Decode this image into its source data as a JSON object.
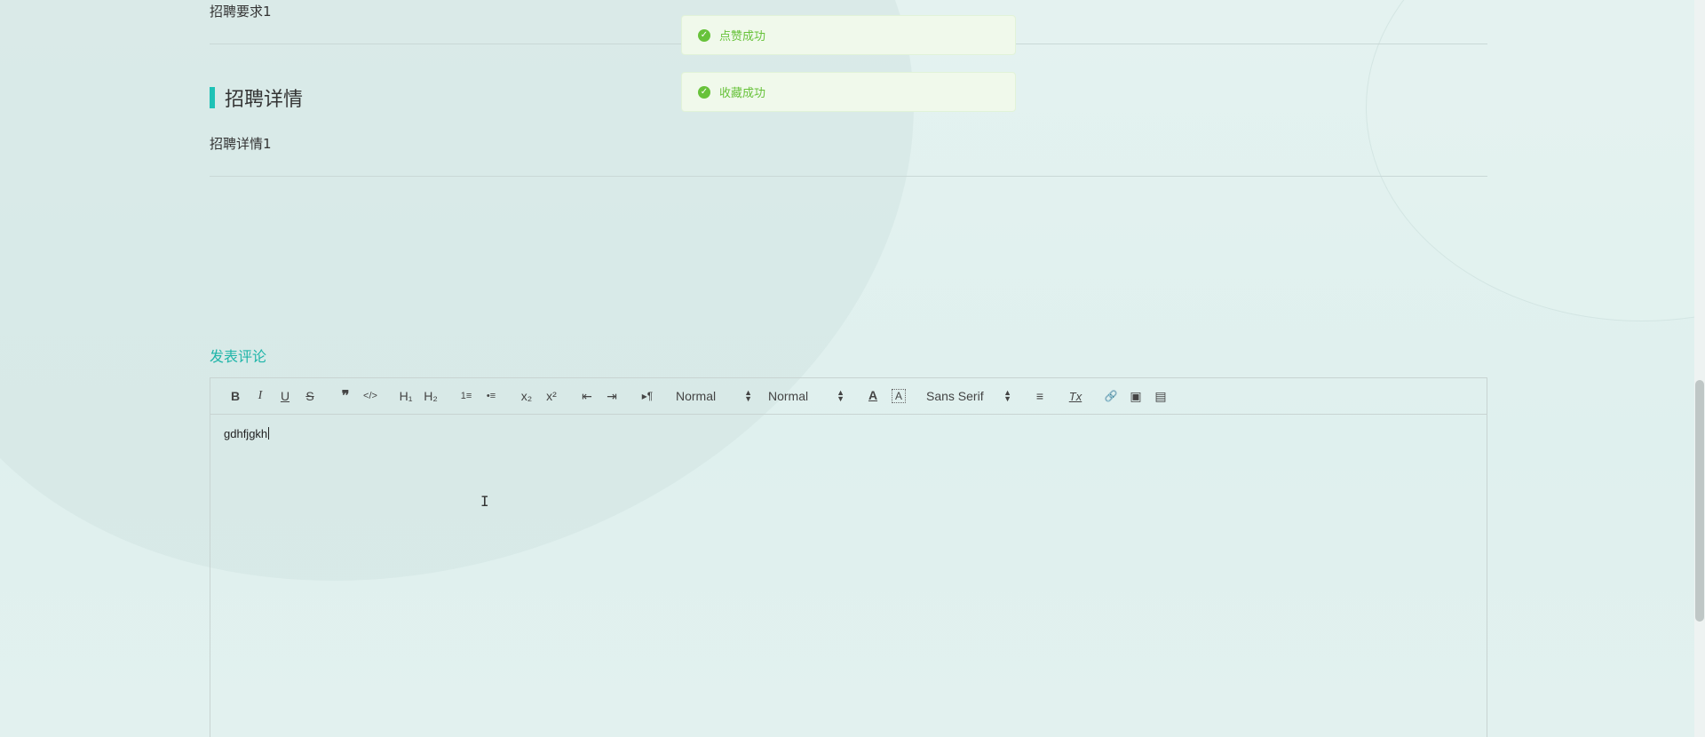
{
  "sections": {
    "requirement_text": "招聘要求1",
    "detail_title": "招聘详情",
    "detail_text": "招聘详情1"
  },
  "comment": {
    "link_label": "发表评论",
    "editor_content": "gdhfjgkh"
  },
  "toolbar": {
    "bold": "B",
    "italic": "I",
    "underline": "U",
    "strike": "S",
    "blockquote": "❞",
    "code": "</>",
    "h1": "H₁",
    "h2": "H₂",
    "ordered_list": "1≡",
    "bullet_list": "•≡",
    "subscript": "x₂",
    "superscript": "x²",
    "indent_decrease": "⇤",
    "indent_increase": "⇥",
    "direction": "▸¶",
    "size_select": "Normal",
    "header_select": "Normal",
    "color": "A",
    "background": "A",
    "font_select": "Sans Serif",
    "align": "≡",
    "clean": "Tx",
    "link": "🔗",
    "image": "▣",
    "video": "▤"
  },
  "toasts": [
    {
      "text": "点赞成功",
      "icon": "check-circle-icon"
    },
    {
      "text": "收藏成功",
      "icon": "check-circle-icon"
    }
  ],
  "colors": {
    "accent": "#1fc2b6",
    "link": "#1fb5a9",
    "success": "#67c23a",
    "success_bg": "#f0f9eb"
  }
}
